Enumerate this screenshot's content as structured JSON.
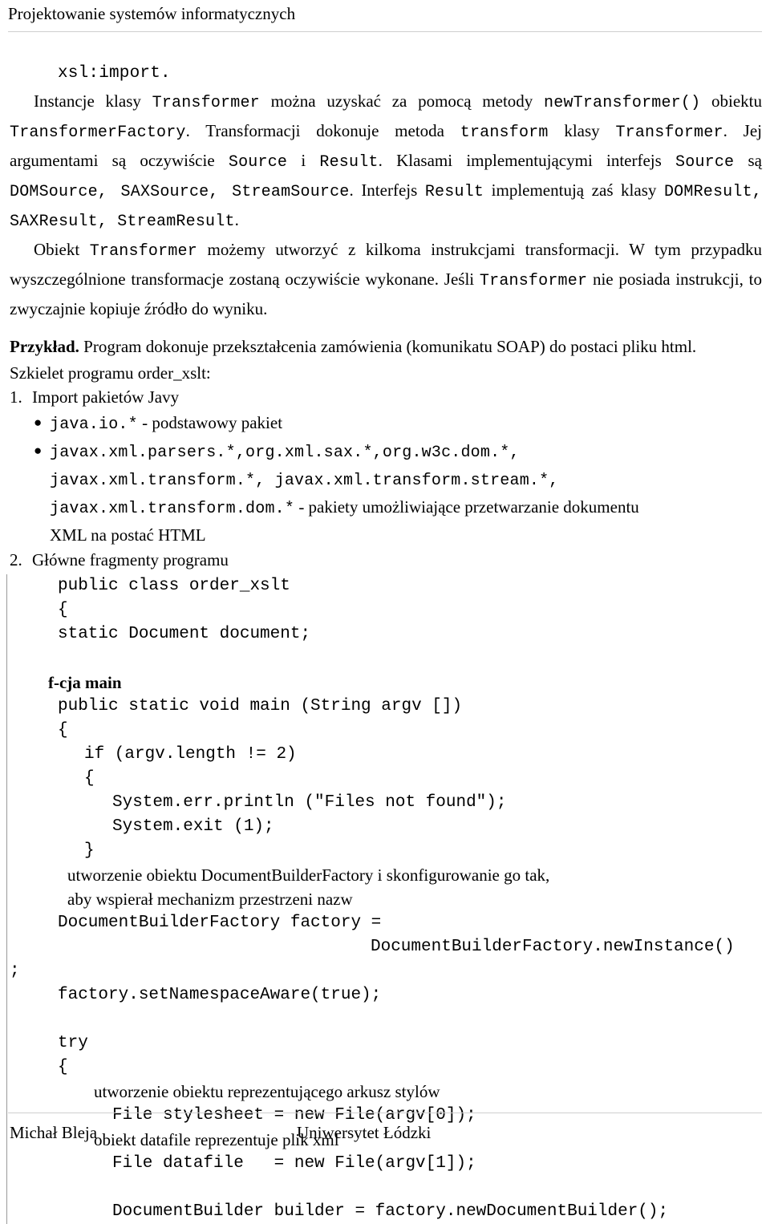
{
  "header": {
    "title": "Projektowanie systemów informatycznych"
  },
  "body": {
    "lead_code": "xsl:import.",
    "para1": {
      "t1": "Instancje klasy ",
      "c1": "Transformer",
      "t2": " można uzyskać za pomocą metody ",
      "c2": "newTransformer()",
      "t3": " obiektu ",
      "c3": "TransformerFactory",
      "t4": ". Transformacji dokonuje metoda ",
      "c4": "transform",
      "t5": " klasy ",
      "c5": "Transformer",
      "t6": ". Jej argumentami są oczywiście ",
      "c6": "Source",
      "t7": " i ",
      "c7": "Result",
      "t8": ". Klasami implementującymi interfejs ",
      "c8": "Source",
      "t9": " są ",
      "c9": "DOMSource, SAXSource, StreamSource",
      "t10": ". Interfejs ",
      "c10": "Result",
      "t11": " implementują zaś klasy ",
      "c11": "DOMResult, SAXResult, StreamResult",
      "t12": "."
    },
    "para2": {
      "t1": "Obiekt ",
      "c1": "Transformer",
      "t2": " możemy utworzyć z kilkoma instrukcjami transformacji. W tym przypadku wyszczególnione transformacje zostaną oczywiście wykonane. Jeśli ",
      "c2": "Transformer",
      "t3": " nie posiada instrukcji, to zwyczajnie kopiuje źródło do wyniku."
    },
    "example": {
      "label": "Przykład.",
      "text": " Program dokonuje przekształcenia zamówienia (komunikatu SOAP) do postaci pliku html."
    },
    "skeleton_line": "Szkielet programu order_xslt:",
    "list": [
      {
        "num": "1.",
        "label": "Import pakietów Javy",
        "bullets": [
          {
            "code": "java.io.*",
            "text": " - podstawowy pakiet",
            "cont": []
          },
          {
            "code": "javax.xml.parsers.*,org.xml.sax.*,org.w3c.dom.*,",
            "text": "",
            "cont": [
              {
                "code": "javax.xml.transform.*, javax.xml.transform.stream.*,",
                "text": ""
              },
              {
                "code": "javax.xml.transform.dom.*",
                "text": " - pakiety umożliwiające przetwarzanie dokumentu"
              },
              {
                "code": "",
                "text": "XML na postać HTML"
              }
            ]
          }
        ]
      },
      {
        "num": "2.",
        "label": "Główne fragmenty programu",
        "bullets": []
      }
    ],
    "code": {
      "l1": "public class order_xslt",
      "l2": "{",
      "l3": "static Document document;",
      "fcja": "f-cja main",
      "l4": "public static void main (String argv [])",
      "l5": "{",
      "l6": "if (argv.length != 2)",
      "l7": "{",
      "l8": "System.err.println (\"Files not found\");",
      "l9": "System.exit (1);",
      "l10": "}",
      "c1": "utworzenie obiektu DocumentBuilderFactory i skonfigurowanie go tak,",
      "c2": "aby wspierał mechanizm przestrzeni nazw",
      "l11": "DocumentBuilderFactory factory =",
      "l12": "DocumentBuilderFactory.newInstance()",
      "l13": ";",
      "l14": "factory.setNamespaceAware(true);",
      "l15": "try",
      "l16": "{",
      "c3": "utworzenie obiektu reprezentującego arkusz stylów",
      "l17": "File stylesheet = new File(argv[0]);",
      "c4": "obiekt datafile reprezentuje plik xml",
      "l18": "File datafile   = new File(argv[1]);",
      "l19": "DocumentBuilder builder = factory.newDocumentBuilder();"
    }
  },
  "footer": {
    "left": "Michał Bleja",
    "right": "Uniwersytet Łódzki"
  }
}
